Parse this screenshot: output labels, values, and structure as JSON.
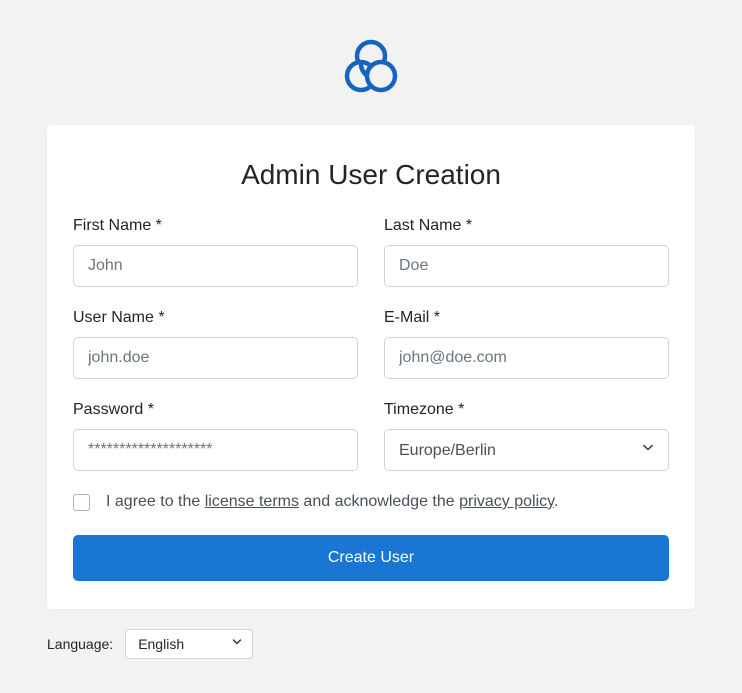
{
  "title": "Admin User Creation",
  "fields": {
    "firstName": {
      "label": "First Name *",
      "placeholder": "John",
      "value": ""
    },
    "lastName": {
      "label": "Last Name *",
      "placeholder": "Doe",
      "value": ""
    },
    "userName": {
      "label": "User Name *",
      "placeholder": "john.doe",
      "value": ""
    },
    "email": {
      "label": "E-Mail *",
      "placeholder": "john@doe.com",
      "value": ""
    },
    "password": {
      "label": "Password *",
      "placeholder": "********************",
      "value": ""
    },
    "timezone": {
      "label": "Timezone *",
      "value": "Europe/Berlin"
    }
  },
  "agree": {
    "pre": "I agree to the ",
    "licenseLink": "license terms",
    "mid": " and acknowledge the ",
    "privacyLink": "privacy policy",
    "post": "."
  },
  "submit": "Create User",
  "language": {
    "label": "Language:",
    "value": "English"
  }
}
